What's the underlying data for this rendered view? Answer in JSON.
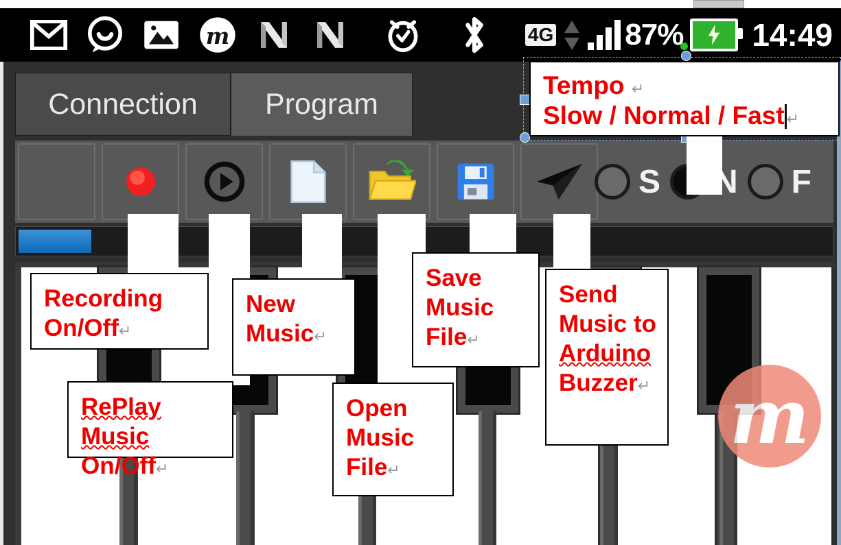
{
  "statusbar": {
    "icons": [
      "gmail-icon",
      "messaging-icon",
      "gallery-icon",
      "m-app-icon",
      "n-app-icon",
      "n-app-icon-2",
      "alarm-icon",
      "bluetooth-icon"
    ],
    "network_label": "4G",
    "battery_percent": "87%",
    "clock": "14:49",
    "battery_state": "charging",
    "battery_color": "#2fb32f"
  },
  "tabs": [
    {
      "label": "Connection",
      "active": false
    },
    {
      "label": "Program",
      "active": true
    }
  ],
  "toolbar": {
    "buttons": [
      {
        "name": "blank-button",
        "icon": ""
      },
      {
        "name": "record-button",
        "icon": "record-icon"
      },
      {
        "name": "replay-button",
        "icon": "play-circle-icon"
      },
      {
        "name": "new-file-button",
        "icon": "new-document-icon"
      },
      {
        "name": "open-file-button",
        "icon": "open-folder-icon"
      },
      {
        "name": "save-file-button",
        "icon": "floppy-disk-save-icon"
      },
      {
        "name": "send-button",
        "icon": "paper-plane-icon"
      }
    ],
    "tempo_options": [
      {
        "label": "S",
        "selected": false
      },
      {
        "label": "N",
        "selected": true
      },
      {
        "label": "F",
        "selected": false
      }
    ]
  },
  "progress": {
    "value_percent": 9
  },
  "watermark": {
    "letter": "m",
    "color": "#ef8a78"
  },
  "annotations": [
    {
      "name": "tempo-callout",
      "title": "Tempo",
      "line2": "Slow / Normal / Fast",
      "text": "Tempo ↵\nSlow / Normal / Fast"
    },
    {
      "name": "recording-callout",
      "text": "Recording\nOn/Off"
    },
    {
      "name": "replay-callout",
      "text": "RePlay Music\nOn/Off",
      "misspelled": "RePlay Music"
    },
    {
      "name": "new-music-callout",
      "text": "New\nMusic"
    },
    {
      "name": "open-music-callout",
      "text": "Open\nMusic\nFile"
    },
    {
      "name": "save-music-callout",
      "text": "Save\nMusic\nFile"
    },
    {
      "name": "send-music-callout",
      "text": "Send\nMusic to\nArduino\nBuzzer",
      "misspelled": "Arduino"
    }
  ],
  "colors": {
    "callout_text": "#ee0000",
    "app_background": "#2f2f2f",
    "toolbar_background": "#585858",
    "progress_fill": "#1a77c4",
    "statusbar_background": "#000000"
  }
}
